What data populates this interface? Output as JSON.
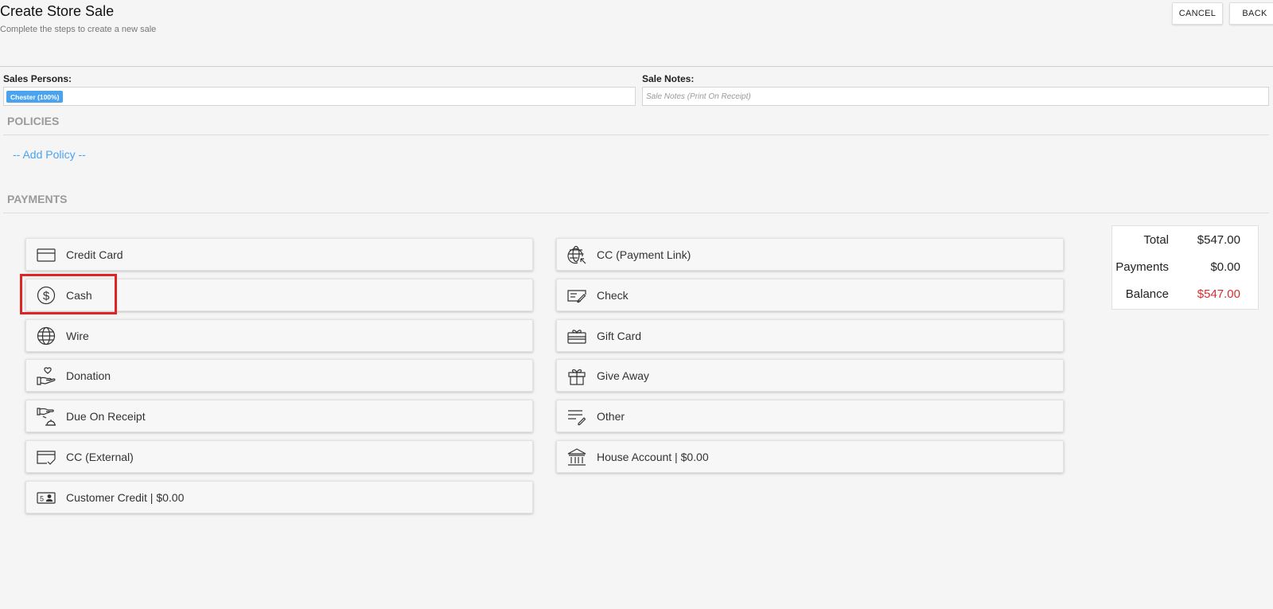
{
  "header": {
    "title": "Create Store Sale",
    "subtitle": "Complete the steps to create a new sale",
    "cancel_label": "CANCEL",
    "back_label": "BACK"
  },
  "sales_persons": {
    "label": "Sales Persons:",
    "chip": "Chester (100%)"
  },
  "sale_notes": {
    "label": "Sale Notes:",
    "placeholder": "Sale Notes (Print On Receipt)"
  },
  "policies": {
    "title": "POLICIES",
    "add_label": "-- Add Policy --"
  },
  "payments": {
    "title": "PAYMENTS",
    "left": [
      {
        "label": "Credit Card",
        "icon": "credit-card-icon"
      },
      {
        "label": "Cash",
        "icon": "dollar-coin-icon"
      },
      {
        "label": "Wire",
        "icon": "globe-icon"
      },
      {
        "label": "Donation",
        "icon": "hand-heart-icon"
      },
      {
        "label": "Due On Receipt",
        "icon": "hand-receipt-icon"
      },
      {
        "label": "CC (External)",
        "icon": "card-check-icon"
      },
      {
        "label": "Customer Credit | $0.00",
        "icon": "id-card-icon"
      }
    ],
    "right": [
      {
        "label": "CC (Payment Link)",
        "icon": "globe-link-icon"
      },
      {
        "label": "Check",
        "icon": "check-icon"
      },
      {
        "label": "Gift Card",
        "icon": "gift-card-icon"
      },
      {
        "label": "Give Away",
        "icon": "gift-icon"
      },
      {
        "label": "Other",
        "icon": "list-edit-icon"
      },
      {
        "label": "House Account | $0.00",
        "icon": "bank-icon"
      }
    ]
  },
  "totals": {
    "total_label": "Total",
    "total_value": "$547.00",
    "payments_label": "Payments",
    "payments_value": "$0.00",
    "balance_label": "Balance",
    "balance_value": "$547.00",
    "balance_color": "#d32f2f"
  },
  "accent_color": "#4aa3ef",
  "highlight_color": "#e02424"
}
